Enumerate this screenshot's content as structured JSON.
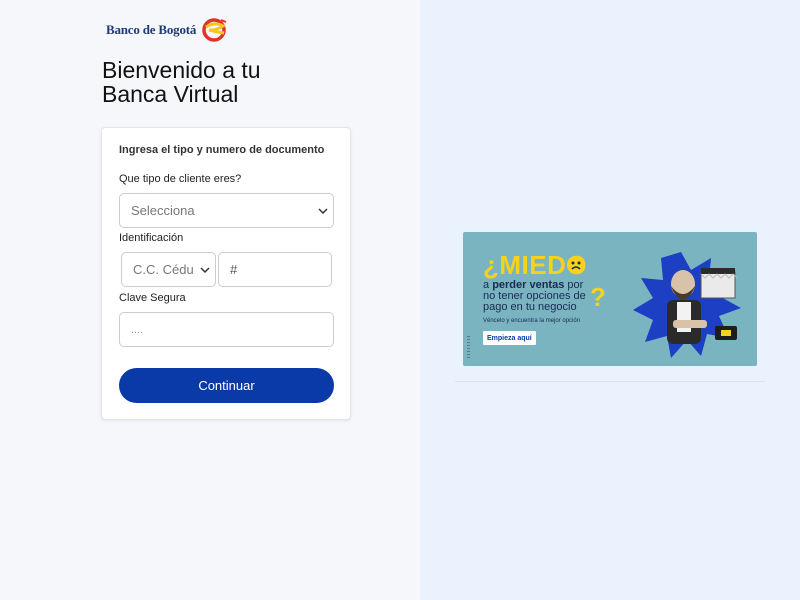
{
  "brand": {
    "name": "Banco de Bogotá",
    "colors": {
      "primary": "#0a3aa7",
      "logo_navy": "#1c3a78",
      "logo_red": "#e5302b",
      "logo_yellow": "#f7c51b"
    }
  },
  "welcome": {
    "line1": "Bienvenido a tu",
    "line2": "Banca Virtual"
  },
  "form": {
    "title": "Ingresa el tipo y numero de documento",
    "client_type_label": "Que tipo de cliente eres?",
    "client_type_value": "Selecciona",
    "id_label": "Identificación",
    "doc_type_value": "C.C. Cédu",
    "doc_number_placeholder": "#",
    "password_label": "Clave Segura",
    "password_value": "....",
    "submit_label": "Continuar"
  },
  "banner": {
    "headline": "¿MIEDO",
    "line_a_bold": "perder ventas",
    "line_a_prefix": "a ",
    "line_a_suffix": " por",
    "line_b": "no tener opciones de",
    "line_c": "pago en tu negocio",
    "question": "?",
    "subtext": "Véncelo y encuentra la mejor opción",
    "cta": "Empieza aquí"
  }
}
